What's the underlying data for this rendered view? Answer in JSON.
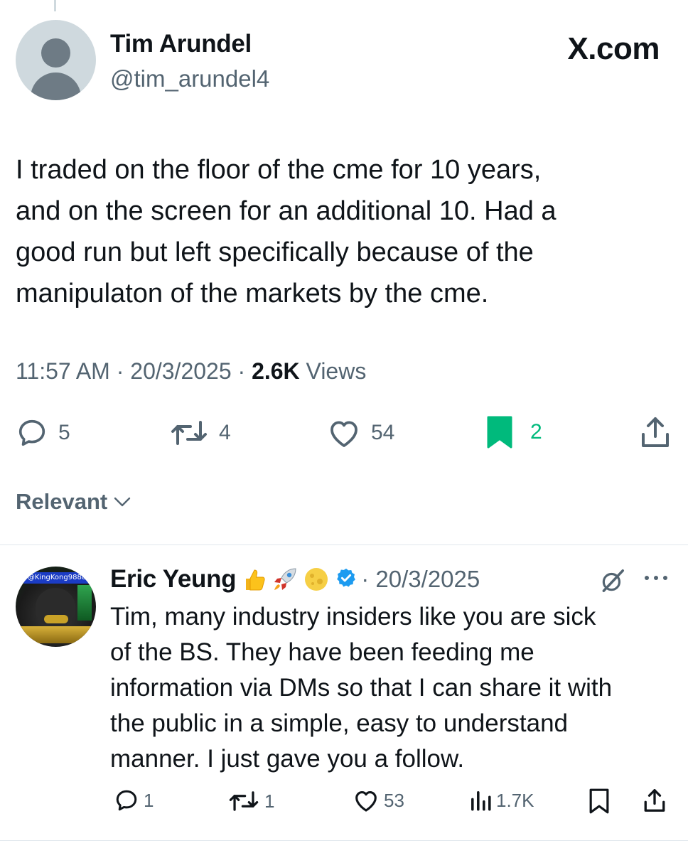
{
  "tweet": {
    "author_name": "Tim Arundel",
    "author_handle": "@tim_arundel4",
    "source_brand": "X.com",
    "text": "I traded on the floor of the cme for 10 years,\nand on the screen for an additional 10.  Had a\ngood run but left specifically because of the\nmanipulaton of the markets by the cme.",
    "time": "11:57 AM",
    "separator": "·",
    "date": "20/3/2025",
    "views_count": "2.6K",
    "views_label": "Views",
    "actions": {
      "replies": "5",
      "reposts": "4",
      "likes": "54",
      "bookmarks": "2",
      "bookmarked": true
    }
  },
  "sort": {
    "label": "Relevant"
  },
  "reply": {
    "author_name": "Eric Yeung",
    "avatar_tag": "@KingKong9888",
    "date_text": "· 20/3/2025",
    "text": "Tim, many industry insiders like you are sick\nof the BS. They have been feeding me\ninformation via DMs so that I can share it with\nthe public in a simple, easy to understand\nmanner. I just gave you a follow.",
    "actions": {
      "replies": "1",
      "reposts": "1",
      "likes": "53",
      "views": "1.7K"
    }
  },
  "icons": {
    "reply": "speech-bubble-icon",
    "repost": "repost-arrows-icon",
    "like": "heart-icon",
    "bookmark": "bookmark-icon",
    "share": "share-upload-icon",
    "views": "bar-chart-icon",
    "grok": "grok-icon",
    "more": "more-dots-icon",
    "verified": "verified-badge-icon"
  },
  "colors": {
    "text_primary": "#0f1419",
    "text_secondary": "#536471",
    "bookmark_active": "#00ba7c",
    "verified": "#1d9bf0",
    "divider": "#e1e8ed"
  }
}
